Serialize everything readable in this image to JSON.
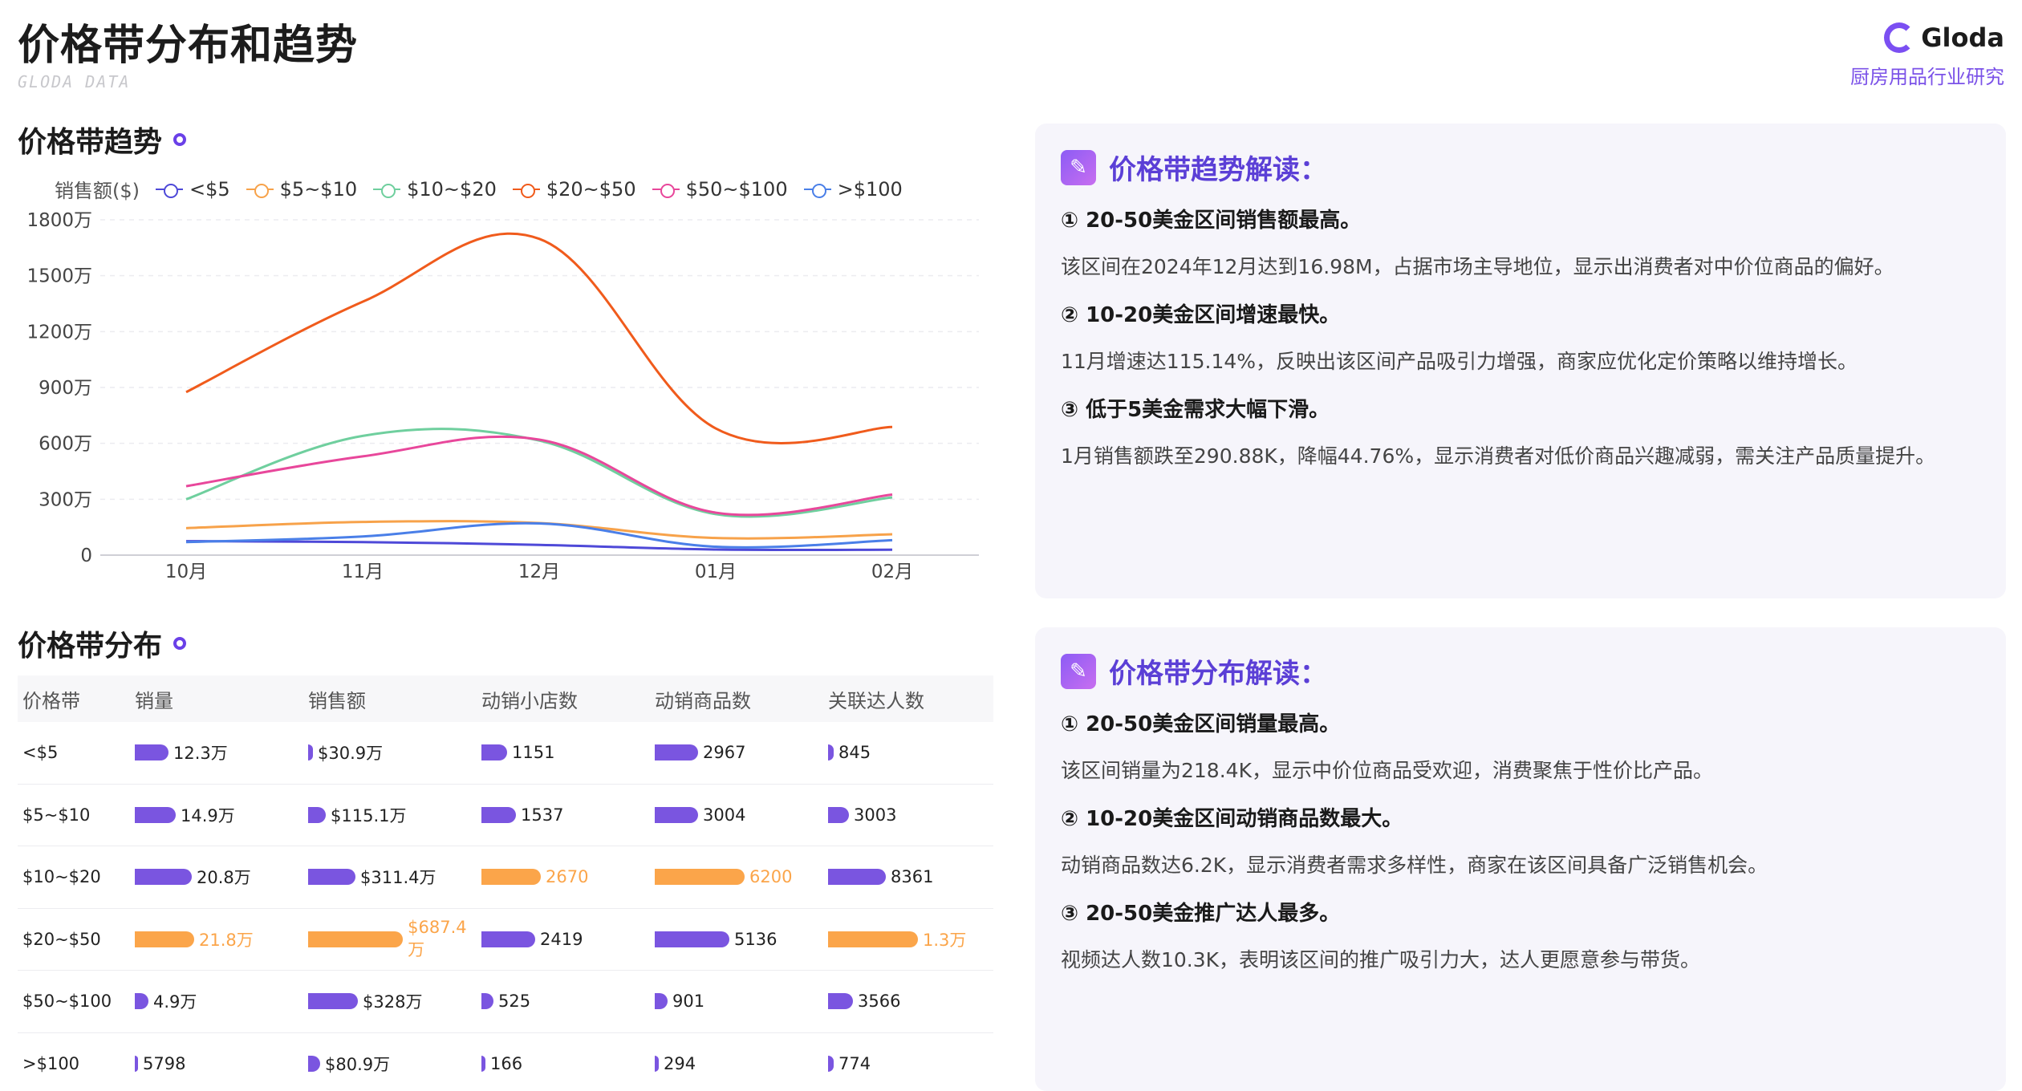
{
  "header": {
    "title": "价格带分布和趋势",
    "subtitle": "GLODA DATA",
    "brand": "Gloda",
    "industry": "厨房用品行业研究"
  },
  "trend_section": {
    "title": "价格带趋势"
  },
  "dist_section": {
    "title": "价格带分布"
  },
  "chart_data": {
    "type": "line",
    "ylabel": "销售额($)",
    "categories": [
      "10月",
      "11月",
      "12月",
      "01月",
      "02月"
    ],
    "yticks": [
      "0",
      "300万",
      "600万",
      "900万",
      "1200万",
      "1500万",
      "1800万"
    ],
    "ylim": [
      0,
      1800
    ],
    "unit": "万",
    "grid": true,
    "legend_position": "top-left",
    "series": [
      {
        "name": "<$5",
        "color": "#4e49d8",
        "values": [
          75,
          70,
          55,
          30,
          29
        ]
      },
      {
        "name": "$5~$10",
        "color": "#f7a24a",
        "values": [
          145,
          178,
          172,
          92,
          112
        ]
      },
      {
        "name": "$10~$20",
        "color": "#6fcf9e",
        "values": [
          300,
          640,
          615,
          220,
          310
        ]
      },
      {
        "name": "$20~$50",
        "color": "#f05b1c",
        "values": [
          875,
          1360,
          1698,
          680,
          688
        ]
      },
      {
        "name": "$50~$100",
        "color": "#e8479b",
        "values": [
          370,
          530,
          620,
          228,
          325
        ]
      },
      {
        "name": ">$100",
        "color": "#4a7fe8",
        "values": [
          70,
          100,
          170,
          45,
          80
        ]
      }
    ]
  },
  "table": {
    "headers": [
      "价格带",
      "销量",
      "销售额",
      "动销小店数",
      "动销商品数",
      "关联达人数"
    ],
    "rows": [
      {
        "band": "<$5",
        "cells": [
          {
            "text": "12.3万",
            "value": 12.3,
            "hl": false
          },
          {
            "text": "$30.9万",
            "value": 30.9,
            "hl": false
          },
          {
            "text": "1151",
            "value": 1151,
            "hl": false
          },
          {
            "text": "2967",
            "value": 2967,
            "hl": false
          },
          {
            "text": "845",
            "value": 845,
            "hl": false
          }
        ]
      },
      {
        "band": "$5~$10",
        "cells": [
          {
            "text": "14.9万",
            "value": 14.9,
            "hl": false
          },
          {
            "text": "$115.1万",
            "value": 115.1,
            "hl": false
          },
          {
            "text": "1537",
            "value": 1537,
            "hl": false
          },
          {
            "text": "3004",
            "value": 3004,
            "hl": false
          },
          {
            "text": "3003",
            "value": 3003,
            "hl": false
          }
        ]
      },
      {
        "band": "$10~$20",
        "cells": [
          {
            "text": "20.8万",
            "value": 20.8,
            "hl": false
          },
          {
            "text": "$311.4万",
            "value": 311.4,
            "hl": false
          },
          {
            "text": "2670",
            "value": 2670,
            "hl": true
          },
          {
            "text": "6200",
            "value": 6200,
            "hl": true
          },
          {
            "text": "8361",
            "value": 8361,
            "hl": false
          }
        ]
      },
      {
        "band": "$20~$50",
        "cells": [
          {
            "text": "21.8万",
            "value": 21.8,
            "hl": true
          },
          {
            "text": "$687.4万",
            "value": 687.4,
            "hl": true
          },
          {
            "text": "2419",
            "value": 2419,
            "hl": false
          },
          {
            "text": "5136",
            "value": 5136,
            "hl": false
          },
          {
            "text": "1.3万",
            "value": 13000,
            "hl": true
          }
        ]
      },
      {
        "band": "$50~$100",
        "cells": [
          {
            "text": "4.9万",
            "value": 4.9,
            "hl": false
          },
          {
            "text": "$328万",
            "value": 328,
            "hl": false
          },
          {
            "text": "525",
            "value": 525,
            "hl": false
          },
          {
            "text": "901",
            "value": 901,
            "hl": false
          },
          {
            "text": "3566",
            "value": 3566,
            "hl": false
          }
        ]
      },
      {
        "band": ">$100",
        "cells": [
          {
            "text": "5798",
            "value": 0.58,
            "hl": false
          },
          {
            "text": "$80.9万",
            "value": 80.9,
            "hl": false
          },
          {
            "text": "166",
            "value": 166,
            "hl": false
          },
          {
            "text": "294",
            "value": 294,
            "hl": false
          },
          {
            "text": "774",
            "value": 774,
            "hl": false
          }
        ]
      }
    ]
  },
  "insights": {
    "trend": {
      "title": "价格带趋势解读：",
      "points": [
        {
          "heading": "① 20-50美金区间销售额最高。",
          "body": "该区间在2024年12月达到16.98M，占据市场主导地位，显示出消费者对中价位商品的偏好。"
        },
        {
          "heading": "② 10-20美金区间增速最快。",
          "body": "11月增速达115.14%，反映出该区间产品吸引力增强，商家应优化定价策略以维持增长。"
        },
        {
          "heading": "③ 低于5美金需求大幅下滑。",
          "body": "1月销售额跌至290.88K，降幅44.76%，显示消费者对低价商品兴趣减弱，需关注产品质量提升。"
        }
      ]
    },
    "distribution": {
      "title": "价格带分布解读：",
      "points": [
        {
          "heading": "① 20-50美金区间销量最高。",
          "body": "该区间销量为218.4K，显示中价位商品受欢迎，消费聚焦于性价比产品。"
        },
        {
          "heading": "② 10-20美金区间动销商品数最大。",
          "body": "动销商品数达6.2K，显示消费者需求多样性，商家在该区间具备广泛销售机会。"
        },
        {
          "heading": "③ 20-50美金推广达人最多。",
          "body": "视频达人数10.3K，表明该区间的推广吸引力大，达人更愿意参与带货。"
        }
      ]
    }
  }
}
